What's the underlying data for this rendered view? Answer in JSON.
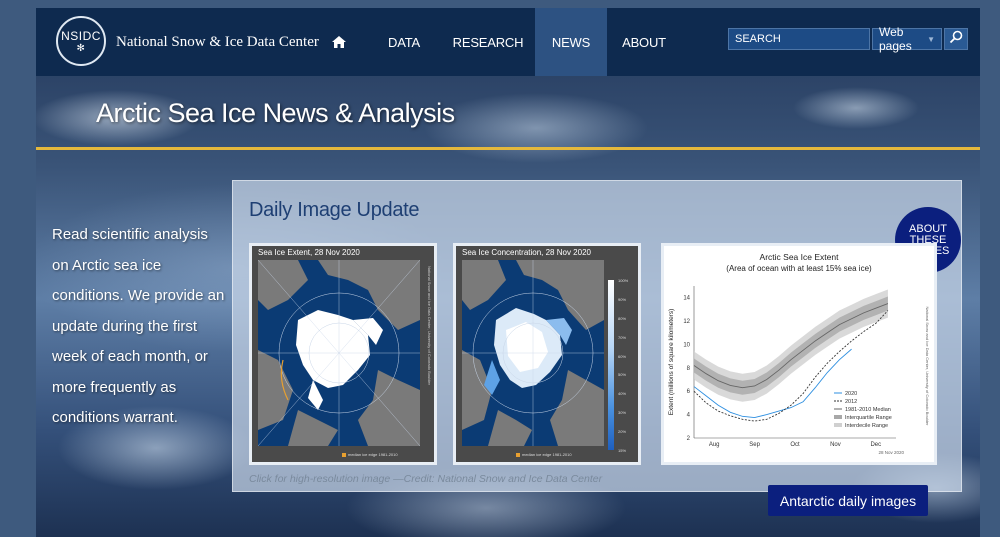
{
  "header": {
    "logo_text": "NSIDC",
    "site_name": "National Snow & Ice Data Center",
    "nav": [
      {
        "label": "DATA"
      },
      {
        "label": "RESEARCH"
      },
      {
        "label": "NEWS"
      },
      {
        "label": "ABOUT"
      }
    ],
    "search_placeholder": "SEARCH",
    "search_scope": "Web pages"
  },
  "page": {
    "title": "Arctic Sea Ice News & Analysis",
    "intro": "Read scientific analysis on Arctic sea ice conditions. We provide an update during the first week of each month, or more frequently as conditions warrant."
  },
  "panel": {
    "title": "Daily Image Update",
    "about_badge": "ABOUT THESE IMAGES",
    "caption": "Click for high-resolution image  —Credit: National Snow and Ice Data Center",
    "extent_map": {
      "title": "Sea Ice Extent, 28 Nov 2020",
      "legend": "median ice edge 1981-2010",
      "credit": "National Snow and Ice Data Center, University of Colorado Boulder"
    },
    "concentration_map": {
      "title": "Sea Ice Concentration, 28 Nov 2020",
      "legend": "median ice edge 1981-2010",
      "credit": "National Snow and Ice Data Center, University of Colorado Boulder",
      "colorbar_labels": [
        "100%",
        "90%",
        "80%",
        "70%",
        "60%",
        "50%",
        "40%",
        "30%",
        "20%",
        "15%"
      ]
    }
  },
  "chart_data": {
    "type": "line",
    "title": "Arctic Sea Ice Extent",
    "subtitle": "(Area of ocean with at least 15% sea ice)",
    "ylabel": "Extent (millions of square kilometers)",
    "xlabel": "",
    "x_ticks": [
      "Aug",
      "Sep",
      "Oct",
      "Nov",
      "Dec"
    ],
    "y_ticks": [
      2,
      4,
      6,
      8,
      10,
      12,
      14
    ],
    "ylim": [
      2,
      15
    ],
    "x_months": [
      0,
      5
    ],
    "side_credit": "National Snow and Ice Data Center, University of Colorado Boulder",
    "date_note": "28 Nov 2020",
    "legend_position": "bottom-right",
    "series": [
      {
        "name": "2020",
        "color": "#2e8fe0",
        "style": "solid",
        "x": [
          0.0,
          0.3,
          0.6,
          0.9,
          1.2,
          1.5,
          1.8,
          2.1,
          2.4,
          2.7,
          3.0,
          3.3,
          3.6,
          3.9
        ],
        "values": [
          6.4,
          5.6,
          4.8,
          4.2,
          3.85,
          3.75,
          4.0,
          4.3,
          4.6,
          5.1,
          6.3,
          7.6,
          8.7,
          9.6
        ]
      },
      {
        "name": "2012",
        "color": "#333333",
        "style": "dashed",
        "x": [
          0.0,
          0.3,
          0.6,
          0.9,
          1.2,
          1.5,
          1.8,
          2.1,
          2.4,
          2.7,
          3.0,
          3.3,
          3.6,
          3.9,
          4.2,
          4.5,
          4.8
        ],
        "values": [
          6.0,
          5.0,
          4.3,
          3.9,
          3.6,
          3.45,
          3.6,
          4.1,
          4.8,
          5.8,
          7.2,
          8.4,
          9.4,
          10.3,
          11.1,
          11.8,
          12.9
        ]
      },
      {
        "name": "1981-2010 Median",
        "color": "#666666",
        "style": "solid",
        "x": [
          0.0,
          0.3,
          0.6,
          0.9,
          1.2,
          1.5,
          1.8,
          2.1,
          2.4,
          2.7,
          3.0,
          3.3,
          3.6,
          3.9,
          4.2,
          4.5,
          4.8
        ],
        "values": [
          8.2,
          7.5,
          6.9,
          6.5,
          6.3,
          6.45,
          7.0,
          7.8,
          8.7,
          9.5,
          10.3,
          11.0,
          11.7,
          12.2,
          12.7,
          13.1,
          13.5
        ]
      }
    ],
    "bands": [
      {
        "name": "Interquartile Range",
        "color": "#a8a8a8",
        "spread": 0.6
      },
      {
        "name": "Interdecile Range",
        "color": "#d0d0d0",
        "spread": 1.2
      }
    ]
  }
}
